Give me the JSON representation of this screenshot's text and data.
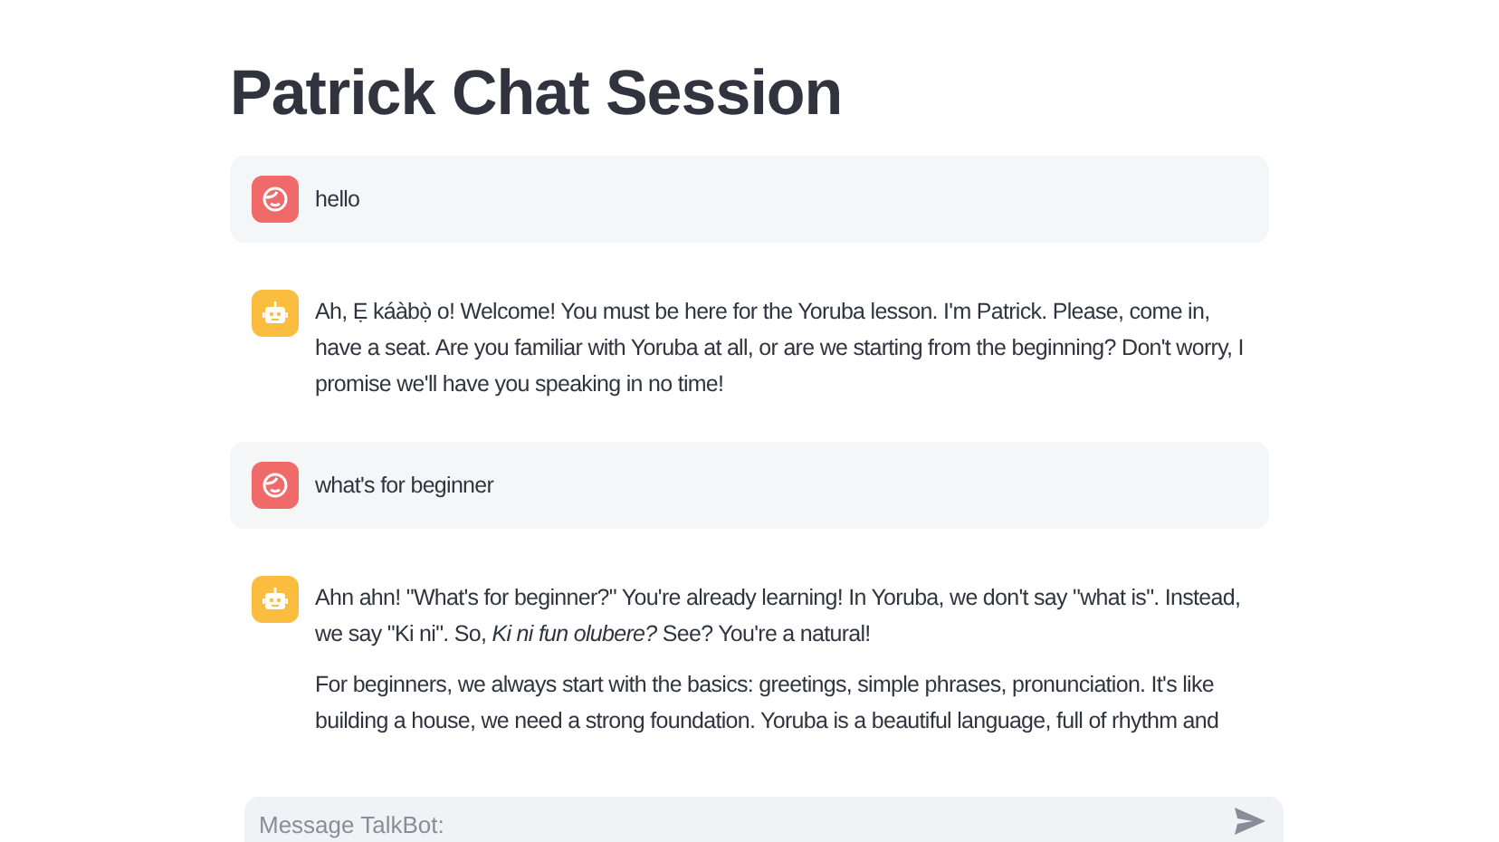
{
  "title": "Patrick Chat Session",
  "messages": [
    {
      "kind": "user",
      "paragraphs": [
        "hello"
      ]
    },
    {
      "kind": "assistant",
      "paragraphs": [
        "Ah, Ẹ káàbọ̀ o! Welcome! You must be here for the Yoruba lesson. I'm Patrick. Please, come in, have a seat. Are you familiar with Yoruba at all, or are we starting from the beginning? Don't worry, I promise we'll have you speaking in no time!"
      ]
    },
    {
      "kind": "user",
      "paragraphs": [
        "what's for beginner"
      ]
    },
    {
      "kind": "assistant",
      "paragraphs": [
        "Ahn ahn! \"What's for beginner?\" You're already learning! In Yoruba, we don't say \"what is\". Instead, we say \"Ki ni\". So, *Ki ni fun olubere?* See? You're a natural!",
        "For beginners, we always start with the basics: greetings, simple phrases, pronunciation. It's like building a house, we need a strong foundation. Yoruba is a beautiful language, full of rhythm and"
      ]
    }
  ],
  "chat_input": {
    "placeholder": "Message TalkBot:"
  }
}
